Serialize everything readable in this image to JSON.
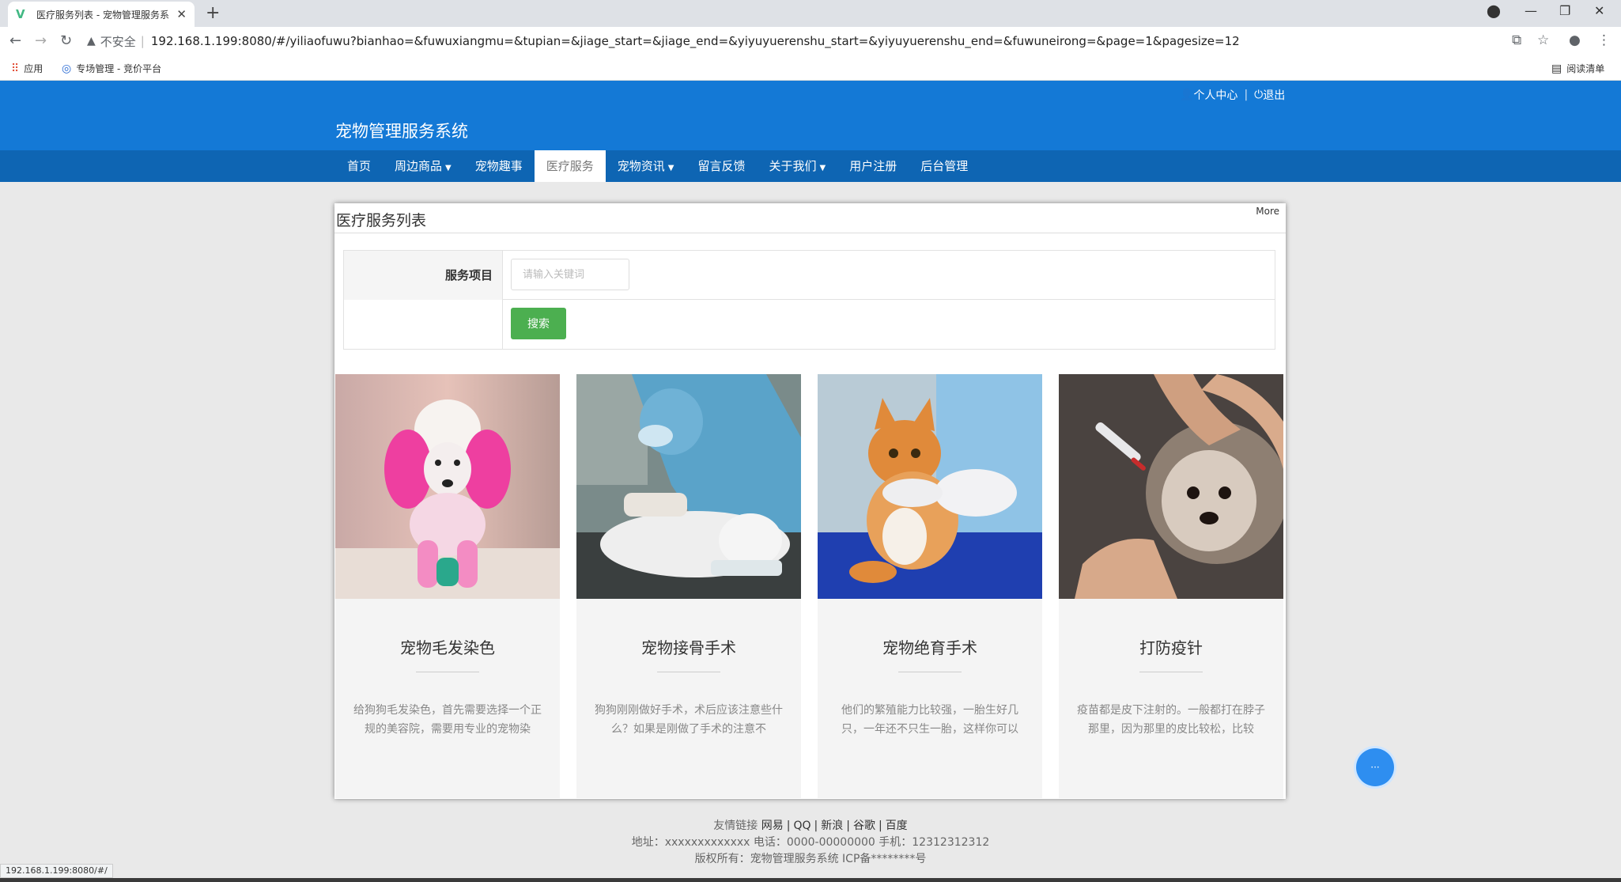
{
  "browser": {
    "tab_title": "医疗服务列表 - 宠物管理服务系",
    "insecure_label": "不安全",
    "url": "192.168.1.199:8080/#/yiliaofuwu?bianhao=&fuwuxiangmu=&tupian=&jiage_start=&jiage_end=&yiyuyuerenshu_start=&yiyuyuerenshu_end=&fuwuneirong=&page=1&pagesize=12",
    "bookmarks": [
      {
        "label": "应用",
        "icon": "apps-grid-icon"
      },
      {
        "label": "专场管理 - 竞价平台",
        "icon": "site-logo-icon"
      }
    ],
    "reading_list": "阅读清单",
    "status_url": "192.168.1.199:8080/#/"
  },
  "header": {
    "site_title": "宠物管理服务系统",
    "user_center": "个人中心",
    "logout": "退出"
  },
  "nav": {
    "items": [
      {
        "label": "首页",
        "dropdown": false
      },
      {
        "label": "周边商品",
        "dropdown": true
      },
      {
        "label": "宠物趣事",
        "dropdown": false
      },
      {
        "label": "医疗服务",
        "dropdown": false,
        "active": true
      },
      {
        "label": "宠物资讯",
        "dropdown": true
      },
      {
        "label": "留言反馈",
        "dropdown": false
      },
      {
        "label": "关于我们",
        "dropdown": true
      },
      {
        "label": "用户注册",
        "dropdown": false
      },
      {
        "label": "后台管理",
        "dropdown": false
      }
    ]
  },
  "panel": {
    "title": "医疗服务列表",
    "more": "More",
    "search": {
      "field_label": "服务项目",
      "placeholder": "请输入关键词",
      "button": "搜索"
    }
  },
  "cards": [
    {
      "title": "宠物毛发染色",
      "desc": "给狗狗毛发染色，首先需要选择一个正规的美容院，需要用专业的宠物染"
    },
    {
      "title": "宠物接骨手术",
      "desc": "狗狗刚刚做好手术，术后应该注意些什么？如果是刚做了手术的注意不"
    },
    {
      "title": "宠物绝育手术",
      "desc": "他们的繁殖能力比较强，一胎生好几只，一年还不只生一胎，这样你可以"
    },
    {
      "title": "打防疫针",
      "desc": "疫苗都是皮下注射的。一般都打在脖子那里，因为那里的皮比较松，比较"
    }
  ],
  "footer": {
    "links_label": "友情链接",
    "links": [
      "网易",
      "QQ",
      "新浪",
      "谷歌",
      "百度"
    ],
    "contact": "地址：xxxxxxxxxxxxx 电话：0000-00000000 手机：12312312312",
    "copyright": "版权所有：宠物管理服务系统 ICP备********号"
  },
  "colors": {
    "header_blue": "#1479d6",
    "nav_blue": "#0e65b3",
    "search_green": "#4caf50"
  }
}
